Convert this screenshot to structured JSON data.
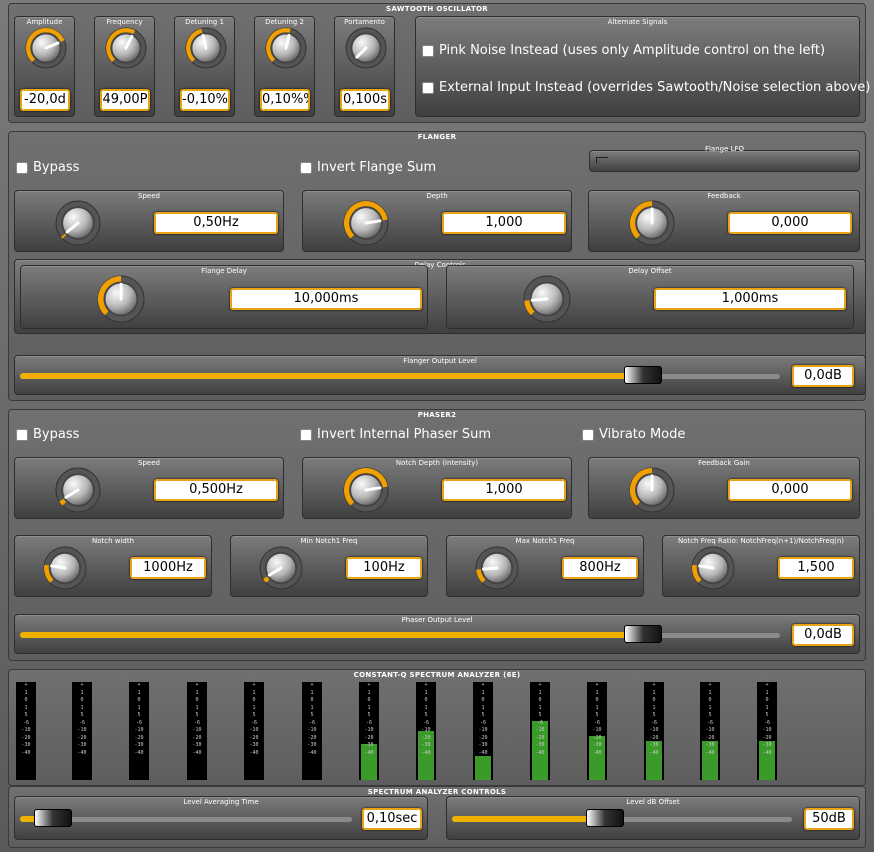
{
  "sawtooth": {
    "title": "SAWTOOTH OSCILLATOR",
    "knobs": [
      {
        "label": "Amplitude",
        "value": "-20,0d",
        "level": 0.75
      },
      {
        "label": "Frequency",
        "value": "49,00P",
        "level": 0.6
      },
      {
        "label": "Detuning 1",
        "value": "-0,10%",
        "level": 0.45
      },
      {
        "label": "Detuning 2",
        "value": "0,10%%",
        "level": 0.55
      },
      {
        "label": "Portamento",
        "value": "0,100s",
        "level": 0.0
      }
    ],
    "alternate": {
      "title": "Alternate Signals",
      "pink": "Pink Noise Instead (uses only Amplitude control on the left)",
      "external": "External Input Instead (overrides Sawtooth/Noise selection above)"
    }
  },
  "flanger": {
    "title": "FLANGER",
    "bypass": "Bypass",
    "invert": "Invert Flange Sum",
    "lfo_title": "Flange LFO",
    "speed": {
      "label": "Speed",
      "value": "0,50Hz",
      "level": 0.02
    },
    "depth": {
      "label": "Depth",
      "value": "1,000",
      "level": 0.8
    },
    "feedback": {
      "label": "Feedback",
      "value": "0,000",
      "level": 0.5
    },
    "delay_title": "Delay Controls",
    "delay": {
      "label": "Flange Delay",
      "value": "10,000ms",
      "level": 0.5
    },
    "offset": {
      "label": "Delay Offset",
      "value": "1,000ms",
      "level": 0.15
    },
    "output": {
      "label": "Flanger Output Level",
      "value": "0,0dB",
      "level": 0.82
    }
  },
  "phaser": {
    "title": "PHASER2",
    "bypass": "Bypass",
    "invert": "Invert Internal Phaser Sum",
    "vibrato": "Vibrato Mode",
    "speed": {
      "label": "Speed",
      "value": "0,500Hz",
      "level": 0.05
    },
    "notch_depth": {
      "label": "Notch Depth (Intensity)",
      "value": "1,000",
      "level": 0.8
    },
    "feedback": {
      "label": "Feedback Gain",
      "value": "0,000",
      "level": 0.5
    },
    "notch_width": {
      "label": "Notch width",
      "value": "1000Hz",
      "level": 0.2
    },
    "min_freq": {
      "label": "Min Notch1 Freq",
      "value": "100Hz",
      "level": 0.05
    },
    "max_freq": {
      "label": "Max Notch1 Freq",
      "value": "800Hz",
      "level": 0.15
    },
    "ratio": {
      "label": "Notch Freq Ratio: NotchFreq(n+1)/NotchFreq(n)",
      "value": "1,500",
      "level": 0.2
    },
    "output": {
      "label": "Phaser Output Level",
      "value": "0,0dB",
      "level": 0.82
    }
  },
  "analyzer": {
    "title": "CONSTANT-Q SPECTRUM ANALYZER (6E)",
    "scale": [
      "+",
      "1",
      "0",
      "1",
      "5",
      "-6",
      "-10",
      "-20",
      "-30",
      "-40"
    ],
    "bands": [
      0,
      0,
      0,
      0,
      0,
      0,
      0.37,
      0.5,
      0.25,
      0.6,
      0.45,
      0.4,
      0.4,
      0.4
    ]
  },
  "controls": {
    "title": "SPECTRUM ANALYZER CONTROLS",
    "averaging": {
      "label": "Level Averaging Time",
      "value": "0,10sec",
      "level": 0.1
    },
    "offset": {
      "label": "Level dB Offset",
      "value": "50dB",
      "level": 0.45
    }
  }
}
